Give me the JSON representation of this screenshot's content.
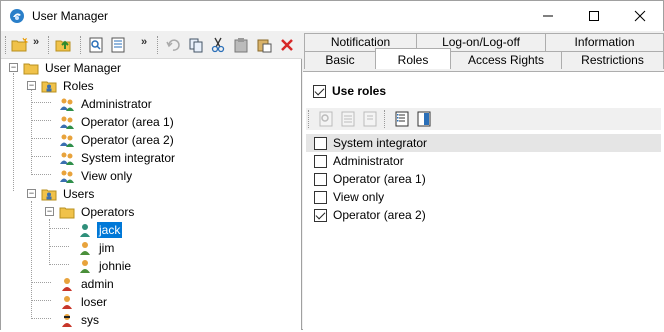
{
  "window": {
    "title": "User Manager",
    "minimize_icon": "minimize-icon",
    "maximize_icon": "maximize-icon",
    "close_icon": "close-icon"
  },
  "left_toolbar": {
    "icons": [
      "new-folder-icon",
      "overflow-chevron-icon",
      "up-folder-icon",
      "properties-icon",
      "details-icon",
      "overflow-chevron-icon",
      "undo-icon",
      "copy-icon",
      "cut-icon",
      "paste-icon",
      "paste-special-icon",
      "delete-icon"
    ],
    "chevron": "»"
  },
  "tree": {
    "root": "User Manager",
    "roles_label": "Roles",
    "roles": [
      "Administrator",
      "Operator (area 1)",
      "Operator (area 2)",
      "System integrator",
      "View only"
    ],
    "users_label": "Users",
    "operators_label": "Operators",
    "operators": [
      "jack",
      "jim",
      "johnie"
    ],
    "users": [
      "admin",
      "loser",
      "sys"
    ],
    "selected": "jack"
  },
  "tabs": {
    "row1": [
      "Notification",
      "Log-on/Log-off",
      "Information"
    ],
    "row2": [
      "Basic",
      "Roles",
      "Access Rights",
      "Restrictions"
    ],
    "active": "Roles"
  },
  "roles_panel": {
    "use_roles_label": "Use roles",
    "use_roles_checked": true,
    "toolbar_icons": [
      "properties-icon",
      "list-icon",
      "list-detail-icon",
      "columns-icon",
      "column-select-icon"
    ],
    "items": [
      {
        "label": "System integrator",
        "checked": false
      },
      {
        "label": "Administrator",
        "checked": false
      },
      {
        "label": "Operator (area 1)",
        "checked": false
      },
      {
        "label": "View only",
        "checked": false
      },
      {
        "label": "Operator (area 2)",
        "checked": true
      }
    ]
  },
  "colors": {
    "selection": "#0078d7",
    "delete_red": "#d62828",
    "folder_yellow": "#f0c24a"
  }
}
